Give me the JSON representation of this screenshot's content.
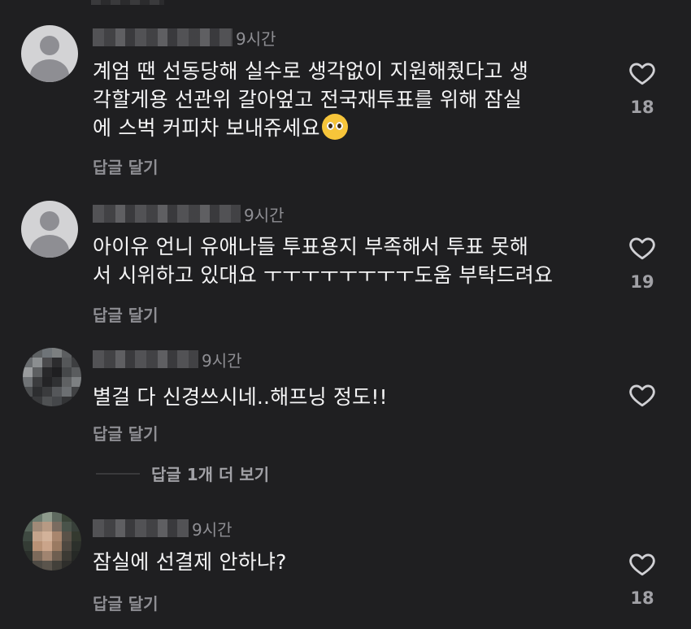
{
  "comments": [
    {
      "time": "9시간",
      "text_lines": [
        "계엄 땐 선동당해 실수로 생각없이 지원해줬다고 생",
        "각할게용 선관위 갈아엎고 전국재투표를 위해 잠실",
        "에 스벅 커피차 보내쥬세요"
      ],
      "emoji": "pleading-face",
      "reply_label": "답글 달기",
      "likes": "18"
    },
    {
      "time": "9시간",
      "text_lines": [
        "아이유 언니 유애나들 투표용지 부족해서 투표 못해",
        "서 시위하고 있대요 ㅜㅜㅜㅜㅜㅜㅜㅜ도움 부탁드려요"
      ],
      "reply_label": "답글 달기",
      "likes": "19"
    },
    {
      "time": "9시간",
      "text_lines": [
        "별걸 다 신경쓰시네..해프닝 정도!!"
      ],
      "reply_label": "답글 달기",
      "likes": ""
    },
    {
      "time": "9시간",
      "text_lines": [
        "잠실에 선결제 안하냐?"
      ],
      "reply_label": "답글 달기",
      "likes": "18"
    }
  ],
  "more_replies_label": "답글 1개 더 보기",
  "icons": {
    "like": "heart-outline-icon",
    "avatar": "default-avatar-icon"
  },
  "colors": {
    "background": "#1f1f21",
    "muted_text": "#8e8e93",
    "text": "#f4f4f5"
  }
}
